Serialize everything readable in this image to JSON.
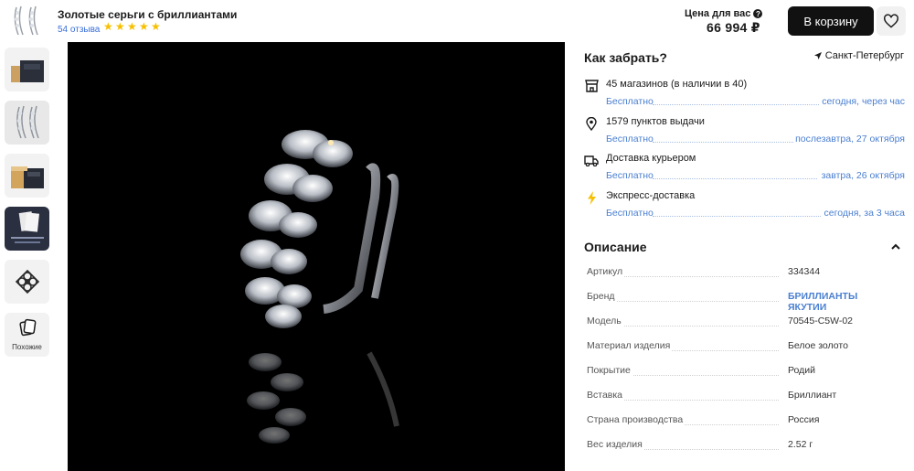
{
  "header": {
    "title": "Золотые серьги с бриллиантами",
    "reviews": "54 отзыва",
    "rating_stars": 5,
    "price_label": "Цена для вас",
    "price_info_icon": "question-circle-icon",
    "price": "66 994 ₽",
    "cart_button": "В корзину",
    "favorite_icon": "heart-icon"
  },
  "gallery": {
    "similar_label": "Похожие",
    "thumbnails": [
      "box-photo",
      "earrings-front",
      "box-open",
      "certificate-card",
      "brand-logo",
      "similar"
    ]
  },
  "delivery": {
    "title": "Как забрать?",
    "city": "Санкт-Петербург",
    "options": [
      {
        "icon": "store-icon",
        "title": "45 магазинов (в наличии в 40)",
        "price": "Бесплатно",
        "when": "сегодня, через час"
      },
      {
        "icon": "location-pin-icon",
        "title": "1579 пунктов выдачи",
        "price": "Бесплатно",
        "when": "послезавтра, 27 октября"
      },
      {
        "icon": "truck-icon",
        "title": "Доставка курьером",
        "price": "Бесплатно",
        "when": "завтра, 26 октября"
      },
      {
        "icon": "lightning-icon",
        "title": "Экспресс-доставка",
        "price": "Бесплатно",
        "when": "сегодня, за 3 часа"
      }
    ]
  },
  "description": {
    "title": "Описание",
    "specs": [
      {
        "key": "Артикул",
        "value": "334344"
      },
      {
        "key": "Бренд",
        "value": "БРИЛЛИАНТЫ ЯКУТИИ"
      },
      {
        "key": "Модель",
        "value": "70545-C5W-02"
      },
      {
        "key": "Материал изделия",
        "value": "Белое золото"
      },
      {
        "key": "Покрытие",
        "value": "Родий"
      },
      {
        "key": "Вставка",
        "value": "Бриллиант"
      },
      {
        "key": "Страна производства",
        "value": "Россия"
      },
      {
        "key": "Вес изделия",
        "value": "2.52 г"
      }
    ]
  },
  "colors": {
    "link": "#4a7fd0",
    "star": "#f6c000",
    "button": "#111111",
    "image_bg": "#000000"
  }
}
